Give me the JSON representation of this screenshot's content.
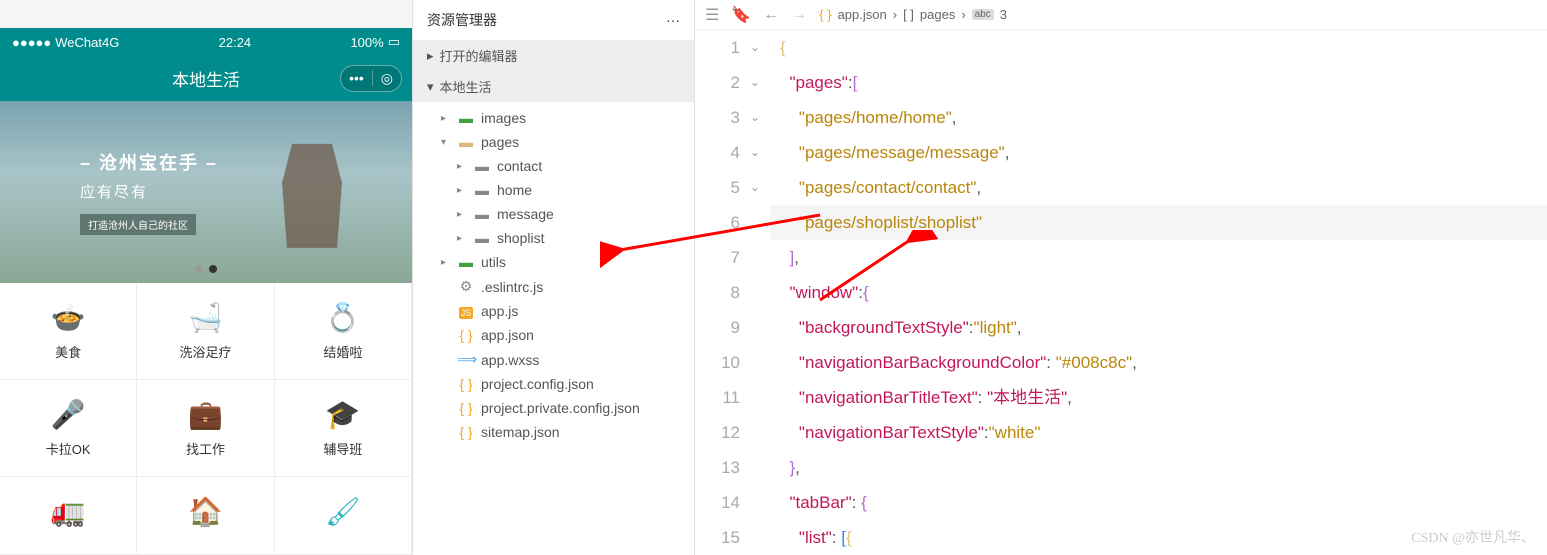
{
  "simulator": {
    "carrier": "WeChat4G",
    "time": "22:24",
    "battery": "100%",
    "navTitle": "本地生活",
    "banner": {
      "title": "– 沧州宝在手 –",
      "subtitle": "应有尽有",
      "tag": "打造沧州人自己的社区"
    },
    "gridItems": [
      {
        "icon": "🍲",
        "label": "美食",
        "color": "teal"
      },
      {
        "icon": "🛁",
        "label": "洗浴足疗",
        "color": "teal"
      },
      {
        "icon": "💍",
        "label": "结婚啦",
        "color": "orange"
      },
      {
        "icon": "🎤",
        "label": "卡拉OK",
        "color": "teal"
      },
      {
        "icon": "💼",
        "label": "找工作",
        "color": "teal"
      },
      {
        "icon": "🎓",
        "label": "辅导班",
        "color": "teal"
      },
      {
        "icon": "🚛",
        "label": "",
        "color": "teal"
      },
      {
        "icon": "🏠",
        "label": "",
        "color": "teal"
      },
      {
        "icon": "🖌",
        "label": "",
        "color": "teal"
      }
    ]
  },
  "explorer": {
    "title": "资源管理器",
    "sections": {
      "openEditors": "打开的编辑器",
      "project": "本地生活"
    },
    "tree": [
      {
        "name": "images",
        "type": "folder",
        "color": "green",
        "indent": 1,
        "expanded": false
      },
      {
        "name": "pages",
        "type": "folder",
        "color": "yellow",
        "indent": 1,
        "expanded": true
      },
      {
        "name": "contact",
        "type": "folder",
        "color": "grey",
        "indent": 2,
        "expanded": false
      },
      {
        "name": "home",
        "type": "folder",
        "color": "grey",
        "indent": 2,
        "expanded": false
      },
      {
        "name": "message",
        "type": "folder",
        "color": "grey",
        "indent": 2,
        "expanded": false
      },
      {
        "name": "shoplist",
        "type": "folder",
        "color": "grey",
        "indent": 2,
        "expanded": false
      },
      {
        "name": "utils",
        "type": "folder",
        "color": "green",
        "indent": 1,
        "expanded": false
      },
      {
        "name": ".eslintrc.js",
        "type": "file",
        "icon": "⚙",
        "indent": 1
      },
      {
        "name": "app.js",
        "type": "file",
        "icon": "JS",
        "indent": 1
      },
      {
        "name": "app.json",
        "type": "file",
        "icon": "{ }",
        "indent": 1
      },
      {
        "name": "app.wxss",
        "type": "file",
        "icon": "⟹",
        "indent": 1
      },
      {
        "name": "project.config.json",
        "type": "file",
        "icon": "{ }",
        "indent": 1
      },
      {
        "name": "project.private.config.json",
        "type": "file",
        "icon": "{ }",
        "indent": 1
      },
      {
        "name": "sitemap.json",
        "type": "file",
        "icon": "{ }",
        "indent": 1
      }
    ]
  },
  "editor": {
    "breadcrumb": {
      "file": "app.json",
      "path1": "pages",
      "path2": "3"
    },
    "lines": [
      {
        "n": 1,
        "fold": "⌄",
        "html": "<span class='tok-brace'>{</span>"
      },
      {
        "n": 2,
        "fold": "⌄",
        "html": "  <span class='tok-key'>\"pages\"</span><span class='tok-punct'>:</span><span class='tok-brace-purple'>[</span>"
      },
      {
        "n": 3,
        "fold": "",
        "html": "    <span class='tok-string'>\"pages/home/home\"</span><span class='tok-punct'>,</span>"
      },
      {
        "n": 4,
        "fold": "",
        "html": "    <span class='tok-string'>\"pages/message/message\"</span><span class='tok-punct'>,</span>"
      },
      {
        "n": 5,
        "fold": "",
        "html": "    <span class='tok-string'>\"pages/contact/contact\"</span><span class='tok-punct'>,</span>"
      },
      {
        "n": 6,
        "fold": "",
        "highlight": true,
        "html": "    <span class='tok-string'>\"pages/shoplist/shoplist\"</span>"
      },
      {
        "n": 7,
        "fold": "",
        "html": "  <span class='tok-brace-purple'>]</span><span class='tok-punct'>,</span>"
      },
      {
        "n": 8,
        "fold": "⌄",
        "html": "  <span class='tok-key'>\"window\"</span><span class='tok-punct'>:</span><span class='tok-brace-purple'>{</span>"
      },
      {
        "n": 9,
        "fold": "",
        "html": "    <span class='tok-key'>\"backgroundTextStyle\"</span><span class='tok-punct'>:</span><span class='tok-string'>\"light\"</span><span class='tok-punct'>,</span>"
      },
      {
        "n": 10,
        "fold": "",
        "html": "    <span class='tok-key'>\"navigationBarBackgroundColor\"</span><span class='tok-punct'>:</span> <span class='tok-string'>\"#008c8c\"</span><span class='tok-punct'>,</span>"
      },
      {
        "n": 11,
        "fold": "",
        "html": "    <span class='tok-key'>\"navigationBarTitleText\"</span><span class='tok-punct'>:</span> <span class='tok-string-cn'>\"本地生活\"</span><span class='tok-punct'>,</span>"
      },
      {
        "n": 12,
        "fold": "",
        "html": "    <span class='tok-key'>\"navigationBarTextStyle\"</span><span class='tok-punct'>:</span><span class='tok-string'>\"white\"</span>"
      },
      {
        "n": 13,
        "fold": "",
        "html": "  <span class='tok-brace-purple'>}</span><span class='tok-punct'>,</span>"
      },
      {
        "n": 14,
        "fold": "⌄",
        "html": "  <span class='tok-key'>\"tabBar\"</span><span class='tok-punct'>:</span> <span class='tok-brace-purple'>{</span>"
      },
      {
        "n": 15,
        "fold": "⌄",
        "html": "    <span class='tok-key'>\"list\"</span><span class='tok-punct'>:</span> <span class='tok-brace-blue'>[</span><span class='tok-brace'>{</span>"
      }
    ]
  },
  "watermark": "CSDN @亦世凡华、"
}
